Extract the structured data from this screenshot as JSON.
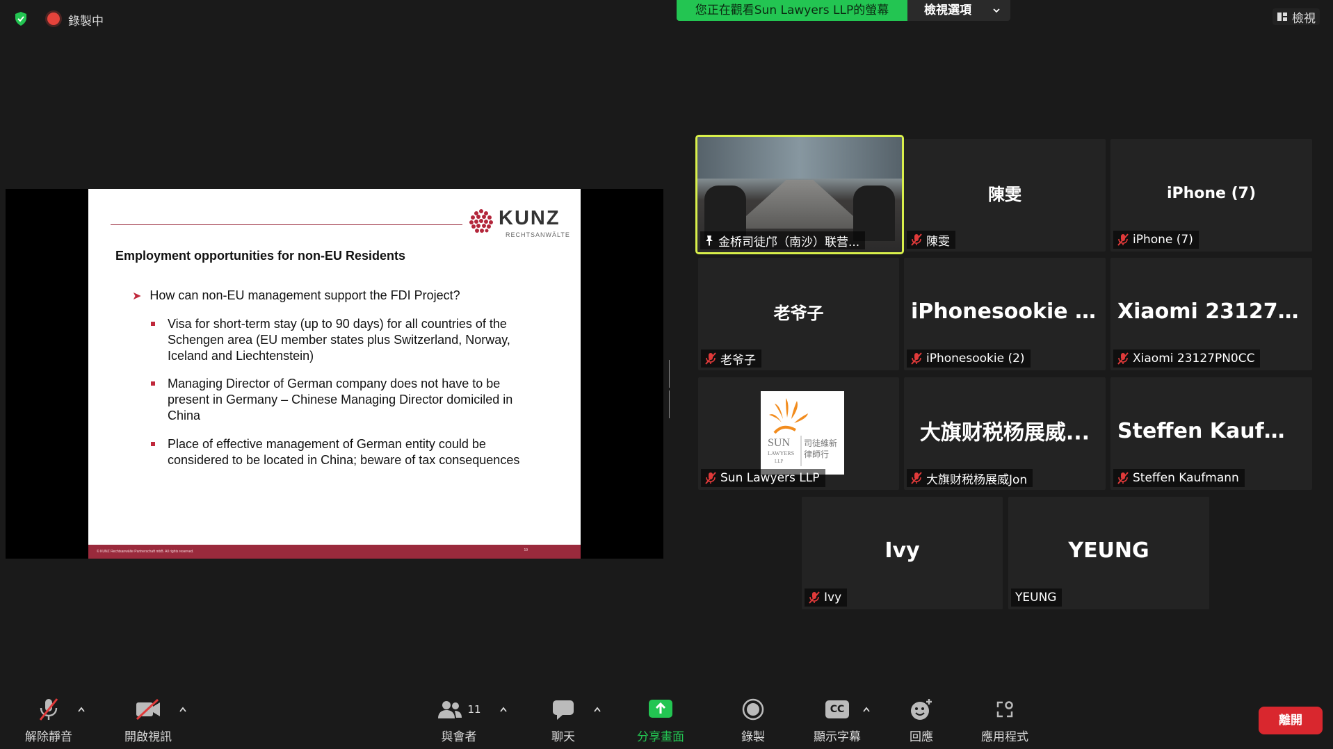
{
  "topbar": {
    "recording_label": "錄製中",
    "share_banner": "您正在觀看Sun Lawyers LLP的螢幕",
    "view_options": "檢視選項",
    "view_button": "檢視"
  },
  "slide": {
    "brand": "KUNZ",
    "brand_sub": "RECHTSANWÄLTE",
    "title": "Employment opportunities for non-EU Residents",
    "question": "How can non-EU management support the FDI Project?",
    "bullets": [
      "Visa for short-term stay (up to 90 days) for all countries of the Schengen area (EU member states plus Switzerland, Norway, Iceland and Liechtenstein)",
      "Managing Director of German company does not have to be present in Germany – Chinese Managing Director domiciled in China",
      "Place of effective management of German entity could be considered to be located in China; beware of tax consequences"
    ],
    "footer_copyright": "© KUNZ Rechtsanwälte Partnerschaft mbB. All rights reserved.",
    "page_number": "19"
  },
  "participants": [
    {
      "display": "",
      "name": "金桥司徒邝（南沙）联营...",
      "muted": false,
      "pinned": true,
      "video": true
    },
    {
      "display": "陳雯",
      "name": "陳雯",
      "muted": true
    },
    {
      "display": "iPhone (7)",
      "name": "iPhone (7)",
      "muted": true
    },
    {
      "display": "老爷子",
      "name": "老爷子",
      "muted": true
    },
    {
      "display": "iPhonesookie (2)",
      "name": "iPhonesookie (2)",
      "muted": true
    },
    {
      "display": "Xiaomi  23127P...",
      "name": "Xiaomi 23127PN0CC",
      "muted": true
    },
    {
      "display": "",
      "name": "Sun Lawyers LLP",
      "muted": true,
      "logo": true
    },
    {
      "display": "大旗财税杨展威...",
      "name": "大旗财税杨展威Jon",
      "muted": true
    },
    {
      "display": "Steffen  Kaufma...",
      "name": "Steffen Kaufmann",
      "muted": true
    },
    {
      "display": "Ivy",
      "name": "Ivy",
      "muted": true
    },
    {
      "display": "YEUNG",
      "name": "YEUNG",
      "muted": false
    }
  ],
  "sun_logo": {
    "line1": "SUN",
    "line2": "LAWYERS",
    "line3": "LLP",
    "cn1": "司徒維新",
    "cn2": "律師行"
  },
  "toolbar": {
    "unmute": "解除靜音",
    "start_video": "開啟視訊",
    "participants": "與會者",
    "participant_count": "11",
    "chat": "聊天",
    "share": "分享畫面",
    "record": "錄製",
    "captions": "顯示字幕",
    "cc_badge": "CC",
    "reactions": "回應",
    "apps": "應用程式",
    "leave": "離開"
  },
  "colors": {
    "accent_green": "#23c552",
    "leave_red": "#d9272e",
    "active_speaker": "#d9f04b",
    "kunz_red": "#9a2a3c"
  }
}
